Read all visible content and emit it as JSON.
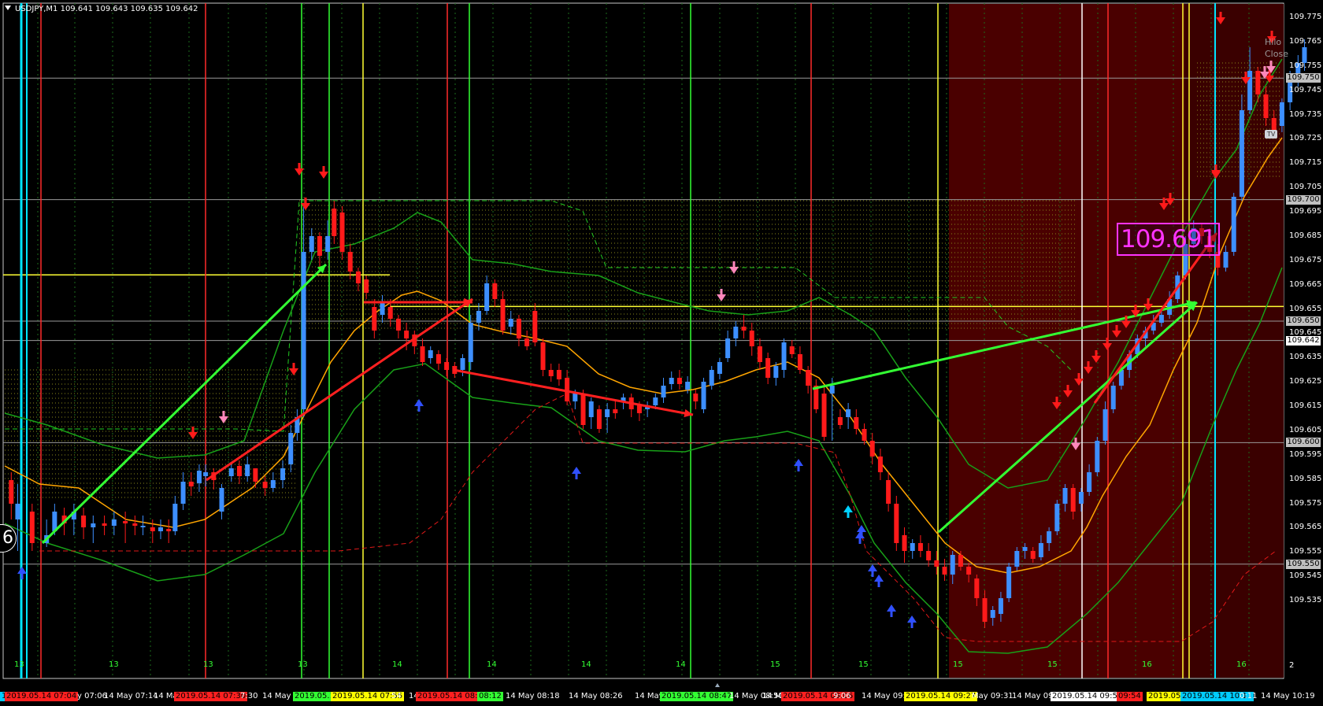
{
  "window": {
    "symbol_line": "USDJPY,M1  109.641 109.643 109.635 109.642",
    "big_price": "109.691",
    "tv_badge": "TV",
    "hilo_lines": [
      "Hilo",
      "Close"
    ],
    "corner_digit": "6"
  },
  "price_axis": {
    "labels": [
      "109.775",
      "109.765",
      "109.755",
      "109.745",
      "109.735",
      "109.725",
      "109.715",
      "109.705",
      "109.695",
      "109.685",
      "109.675",
      "109.665",
      "109.655",
      "109.645",
      "109.635",
      "109.625",
      "109.615",
      "109.605",
      "109.595",
      "109.585",
      "109.575",
      "109.565",
      "109.555",
      "109.545",
      "109.535"
    ],
    "highlight_boxes": [
      {
        "text": "109.750",
        "bg": "#c0c0c0",
        "fg": "#000000"
      },
      {
        "text": "109.700",
        "bg": "#c0c0c0",
        "fg": "#000000"
      },
      {
        "text": "109.650",
        "bg": "#c0c0c0",
        "fg": "#000000"
      },
      {
        "text": "109.642",
        "bg": "#ffffff",
        "fg": "#000000"
      },
      {
        "text": "109.600",
        "bg": "#c0c0c0",
        "fg": "#000000"
      },
      {
        "text": "109.550",
        "bg": "#c0c0c0",
        "fg": "#000000"
      }
    ],
    "bottom_mark": "2"
  },
  "time_axis": {
    "labels": [
      {
        "text": "19",
        "kind": "box",
        "bg": "#00ccff"
      },
      {
        "text": "2019.05.14 07:04",
        "kind": "box",
        "bg": "#ff2020"
      },
      {
        "text": "y 07:06",
        "kind": "plain"
      },
      {
        "text": "14 May 07:14",
        "kind": "plain"
      },
      {
        "text": "14 Ma",
        "kind": "plain"
      },
      {
        "text": "2019.05.14 07:30",
        "kind": "box",
        "bg": "#ff2020"
      },
      {
        "text": "7:30",
        "kind": "plain"
      },
      {
        "text": "14 May 07:",
        "kind": "plain"
      },
      {
        "text": "2019.05.14",
        "kind": "box",
        "bg": "#33ff33"
      },
      {
        "text": "2019.05.14 07:55",
        "kind": "box",
        "bg": "#ffff00"
      },
      {
        "text": "54",
        "kind": "plain"
      },
      {
        "text": "14",
        "kind": "plain"
      },
      {
        "text": "2019.05.14 08:08",
        "kind": "box",
        "bg": "#ff2020"
      },
      {
        "text": "08:12",
        "kind": "box",
        "bg": "#33ff33"
      },
      {
        "text": "14 May 08:18",
        "kind": "plain"
      },
      {
        "text": "14 May 08:26",
        "kind": "plain"
      },
      {
        "text": "14 May 08:34",
        "kind": "plain"
      },
      {
        "text": "2019.05.14 08:47",
        "kind": "box",
        "bg": "#33ff33"
      },
      {
        "text": "14 May 08:50",
        "kind": "plain"
      },
      {
        "text": "14 Ma",
        "kind": "plain"
      },
      {
        "text": "2019.05.14 09:06",
        "kind": "box",
        "bg": "#ff2020"
      },
      {
        "text": "9:06",
        "kind": "plain"
      },
      {
        "text": "14 May 09:15",
        "kind": "plain"
      },
      {
        "text": "2019.05.14 09:27",
        "kind": "box",
        "bg": "#ffff00"
      },
      {
        "text": "May 09:31",
        "kind": "plain"
      },
      {
        "text": "14 May 09:",
        "kind": "plain"
      },
      {
        "text": "2019.05.14 09:50",
        "kind": "box",
        "bg": "#ffffff"
      },
      {
        "text": "09:54",
        "kind": "box",
        "bg": "#ff2020"
      },
      {
        "text": "2019.05.",
        "kind": "box",
        "bg": "#ffff00"
      },
      {
        "text": "2019.05.14 10:11",
        "kind": "box",
        "bg": "#00ccff"
      },
      {
        "text": "0:11",
        "kind": "plain"
      },
      {
        "text": "14 May 10:19",
        "kind": "plain"
      }
    ],
    "hour_marks": [
      "13",
      "13",
      "13",
      "13",
      "14",
      "14",
      "14",
      "14",
      "15",
      "15",
      "15",
      "15",
      "16",
      "16"
    ]
  },
  "chart_data": {
    "type": "candlestick",
    "symbol": "USDJPY",
    "timeframe": "M1",
    "ylim": [
      109.532,
      109.78
    ],
    "reference_lines": {
      "yellow_horizontal": [
        109.669,
        109.656
      ],
      "bid_price": 109.642
    },
    "annotation_price": 109.691
  },
  "colors": {
    "bull": "#3d8fff",
    "bear": "#ff1a1a",
    "ma_orange": "#ffa500",
    "band_green": "#18a018",
    "arrow_green": "#33ff33",
    "arrow_red": "#ff2020",
    "session_shade": "#4a0000"
  }
}
